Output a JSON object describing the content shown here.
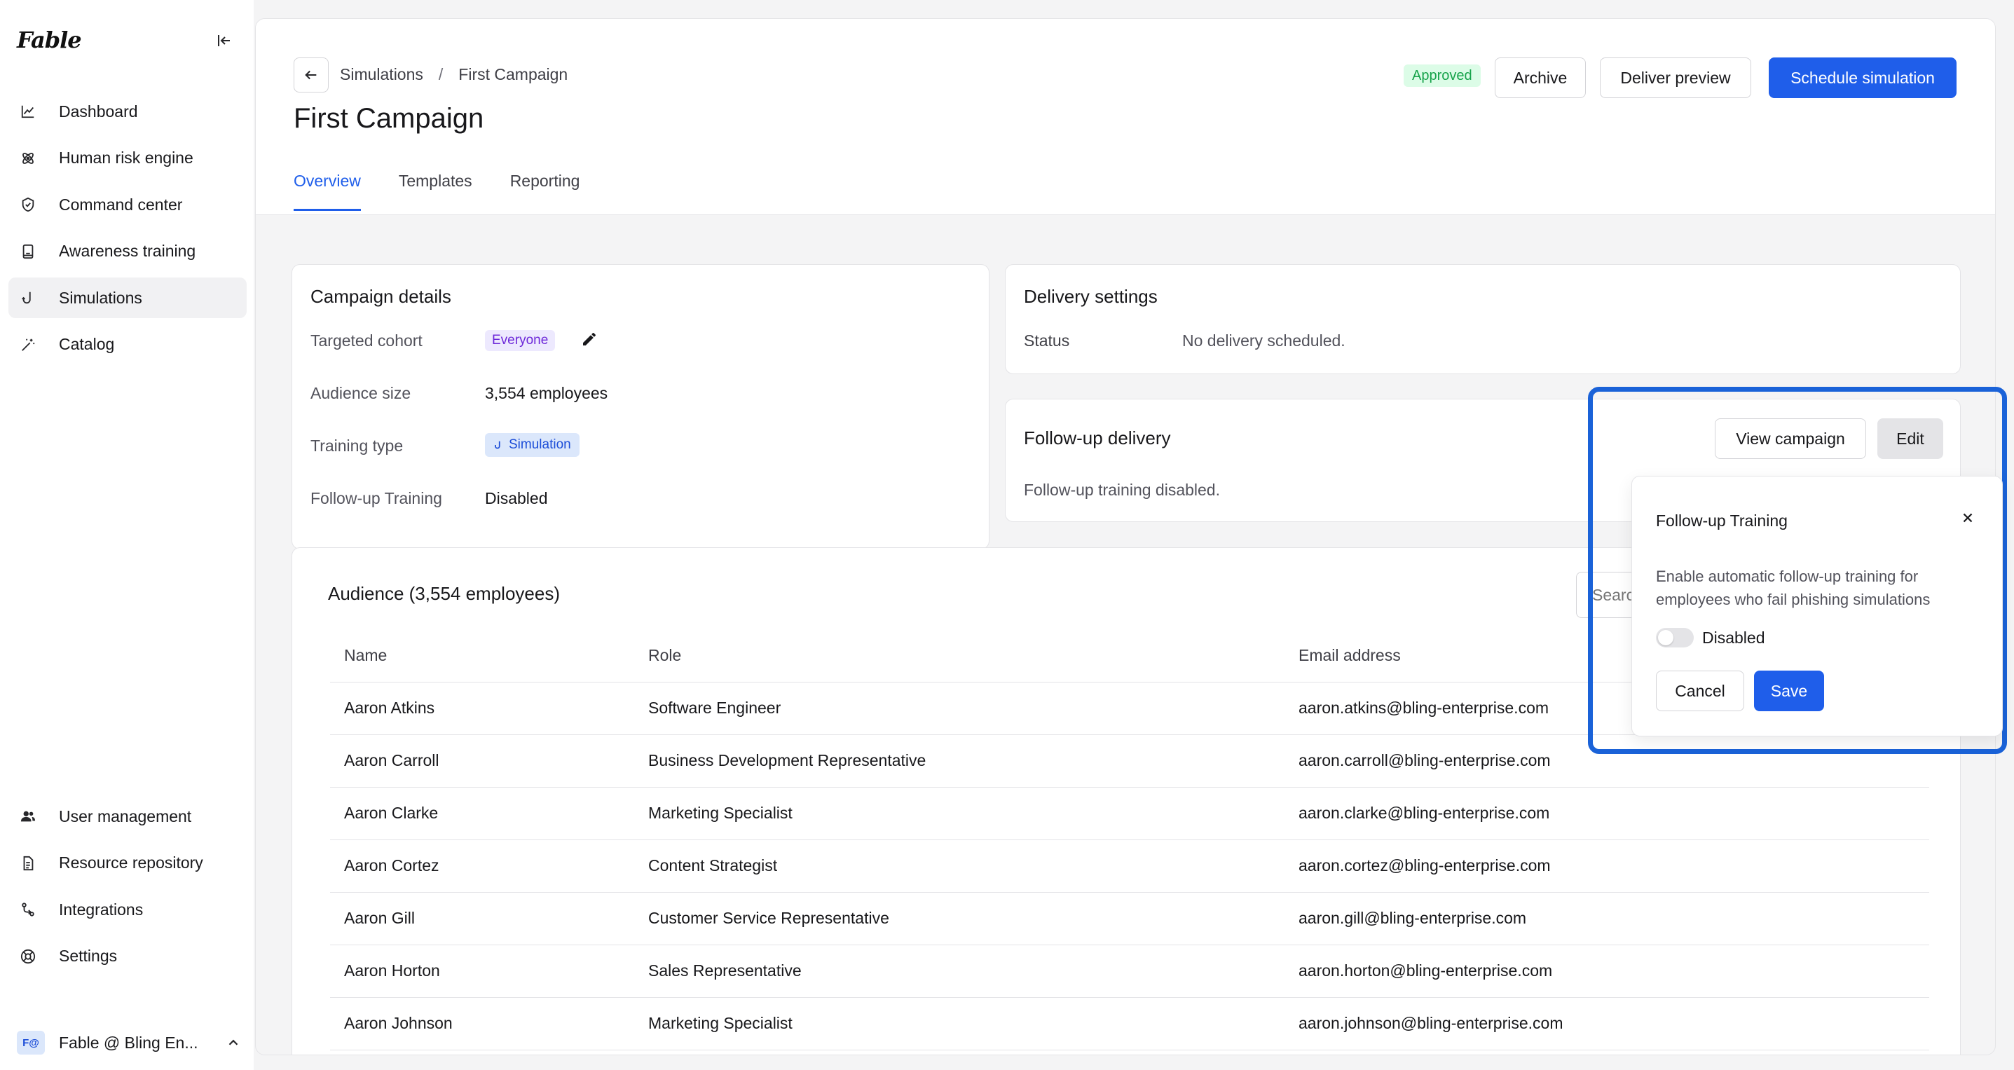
{
  "app": {
    "logo": "Fable"
  },
  "sidebar": {
    "items": [
      {
        "label": "Dashboard",
        "icon": "chart-line-icon"
      },
      {
        "label": "Human risk engine",
        "icon": "atom-icon"
      },
      {
        "label": "Command center",
        "icon": "shield-check-icon"
      },
      {
        "label": "Awareness training",
        "icon": "book-icon"
      },
      {
        "label": "Simulations",
        "icon": "hook-icon",
        "active": true
      },
      {
        "label": "Catalog",
        "icon": "magic-wand-icon"
      }
    ],
    "bottom_items": [
      {
        "label": "User management",
        "icon": "users-icon"
      },
      {
        "label": "Resource repository",
        "icon": "file-text-icon"
      },
      {
        "label": "Integrations",
        "icon": "git-branch-icon"
      },
      {
        "label": "Settings",
        "icon": "lifebuoy-icon"
      }
    ],
    "org": {
      "badge": "F@",
      "name": "Fable @ Bling En..."
    }
  },
  "header": {
    "breadcrumb": [
      "Simulations",
      "First Campaign"
    ],
    "breadcrumb_sep": "/",
    "title": "First Campaign",
    "status": "Approved",
    "archive_label": "Archive",
    "deliver_preview_label": "Deliver preview",
    "schedule_label": "Schedule simulation",
    "tabs": [
      "Overview",
      "Templates",
      "Reporting"
    ]
  },
  "campaign_details": {
    "title": "Campaign details",
    "targeted_cohort_label": "Targeted cohort",
    "targeted_cohort_value": "Everyone",
    "audience_size_label": "Audience size",
    "audience_size_value": "3,554 employees",
    "training_type_label": "Training type",
    "training_type_value": "Simulation",
    "followup_label": "Follow-up Training",
    "followup_value": "Disabled"
  },
  "delivery_settings": {
    "title": "Delivery settings",
    "status_label": "Status",
    "status_value": "No delivery scheduled."
  },
  "followup_delivery": {
    "title": "Follow-up delivery",
    "text": "Follow-up training disabled.",
    "view_campaign_label": "View campaign",
    "edit_label": "Edit"
  },
  "audience": {
    "title": "Audience (3,554 employees)",
    "search_placeholder": "Search",
    "columns": [
      "Name",
      "Role",
      "Email address"
    ],
    "rows": [
      [
        "Aaron Atkins",
        "Software Engineer",
        "aaron.atkins@bling-enterprise.com"
      ],
      [
        "Aaron Carroll",
        "Business Development Representative",
        "aaron.carroll@bling-enterprise.com"
      ],
      [
        "Aaron Clarke",
        "Marketing Specialist",
        "aaron.clarke@bling-enterprise.com"
      ],
      [
        "Aaron Cortez",
        "Content Strategist",
        "aaron.cortez@bling-enterprise.com"
      ],
      [
        "Aaron Gill",
        "Customer Service Representative",
        "aaron.gill@bling-enterprise.com"
      ],
      [
        "Aaron Horton",
        "Sales Representative",
        "aaron.horton@bling-enterprise.com"
      ],
      [
        "Aaron Johnson",
        "Marketing Specialist",
        "aaron.johnson@bling-enterprise.com"
      ]
    ]
  },
  "popover": {
    "title": "Follow-up Training",
    "description": "Enable automatic follow-up training for employees who fail phishing simulations",
    "toggle_label": "Disabled",
    "toggle_on": false,
    "cancel_label": "Cancel",
    "save_label": "Save"
  },
  "colors": {
    "accent": "#1f5eea",
    "highlight": "#1a62d8",
    "approved": "#16a34a"
  }
}
